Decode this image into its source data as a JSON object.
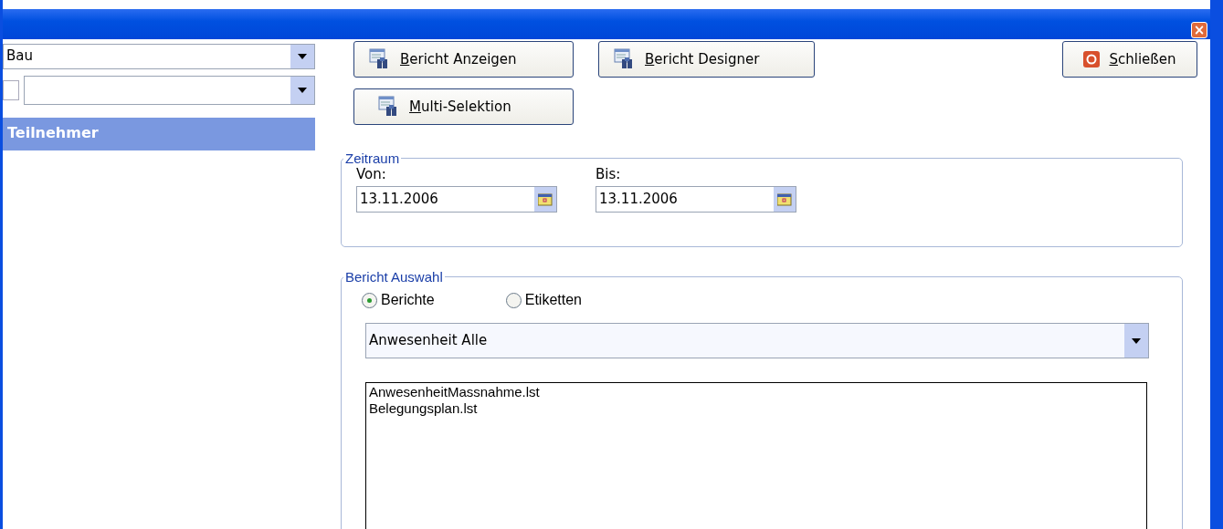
{
  "window": {
    "close_button": "×"
  },
  "sidebar": {
    "combo_1": {
      "value": "Bau"
    },
    "checkbox": {
      "checked": false
    },
    "header": "Teilnehmer"
  },
  "buttons": [
    {
      "label": "Bericht Anzeigen",
      "kind": "report"
    },
    {
      "label": "Bericht Designer",
      "kind": "report"
    },
    {
      "label": "Multi-Selektion",
      "kind": "report"
    }
  ],
  "close": {
    "label": "Schließen"
  },
  "zeitraum": {
    "title": "Zeitraum",
    "fields": [
      {
        "label": "Von:",
        "value": "13.11.2006"
      },
      {
        "label": "Bis:",
        "value": "13.11.2006"
      }
    ]
  },
  "bericht_auswahl": {
    "title": "Bericht Auswahl",
    "options": [
      {
        "label": "Berichte",
        "selected": true
      },
      {
        "label": "Etiketten",
        "selected": false
      }
    ],
    "combo": {
      "value": "Anwesenheit Alle"
    },
    "list": [
      "AnwesenheitMassnahme.lst",
      "Belegungsplan.lst"
    ]
  }
}
